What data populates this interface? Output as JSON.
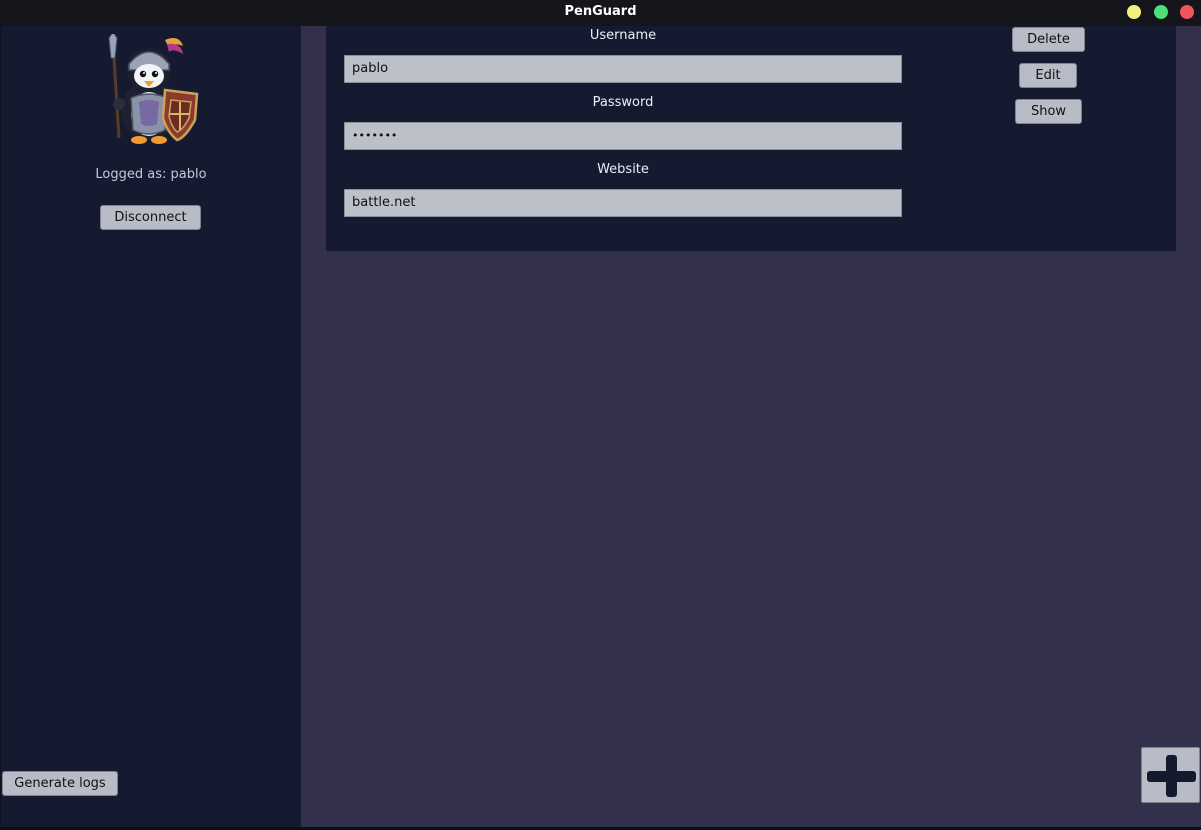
{
  "window": {
    "title": "PenGuard",
    "controls": {
      "minimize_color": "#f4f07e",
      "maximize_color": "#4be07a",
      "close_color": "#f2545b"
    }
  },
  "sidebar": {
    "logo_icon": "penguin-knight-logo",
    "logged_as": "Logged as: pablo",
    "disconnect_label": "Disconnect",
    "generate_logs_label": "Generate logs"
  },
  "entry": {
    "username_label": "Username",
    "username_value": "pablo",
    "password_label": "Password",
    "password_value": "•••••••",
    "website_label": "Website",
    "website_value": "battle.net",
    "delete_label": "Delete",
    "edit_label": "Edit",
    "show_label": "Show"
  },
  "add_button": {
    "icon": "plus-icon"
  }
}
